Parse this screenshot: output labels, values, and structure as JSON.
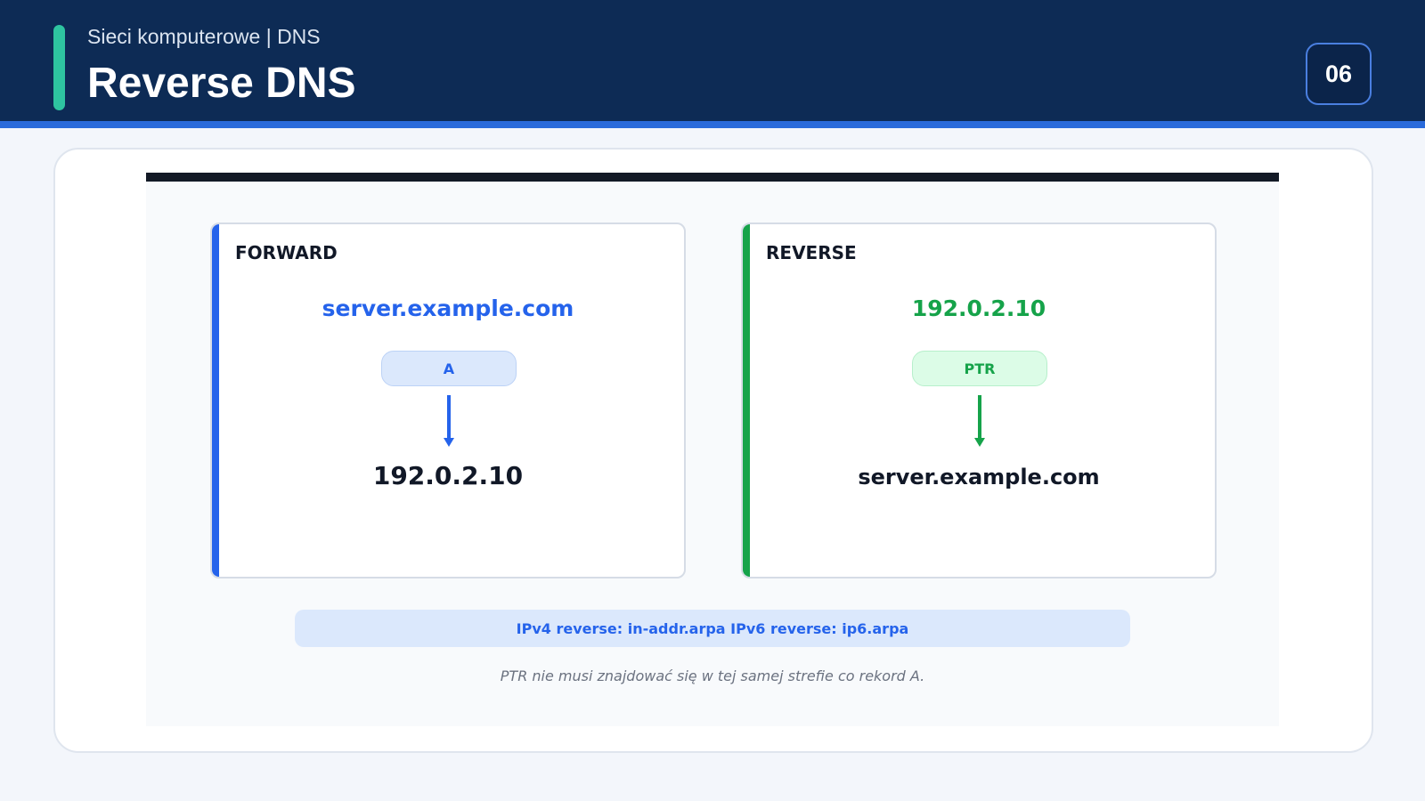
{
  "header": {
    "subtitle": "Sieci komputerowe | DNS",
    "title": "Reverse DNS",
    "page_number": "06"
  },
  "colors": {
    "header_bg": "#0d2b55",
    "accent": "#2ec4a0",
    "forward": "#2563eb",
    "reverse": "#16a34a"
  },
  "forward": {
    "label": "FORWARD",
    "source": "server.example.com",
    "record": "A",
    "target": "192.0.2.10",
    "arrow_icon": "arrow-down-icon"
  },
  "reverse": {
    "label": "REVERSE",
    "source": "192.0.2.10",
    "record": "PTR",
    "target": "server.example.com",
    "arrow_icon": "arrow-down-icon"
  },
  "info": "IPv4 reverse: in-addr.arpa IPv6 reverse: ip6.arpa",
  "note": "PTR nie musi znajdować się w tej samej strefie co rekord A."
}
